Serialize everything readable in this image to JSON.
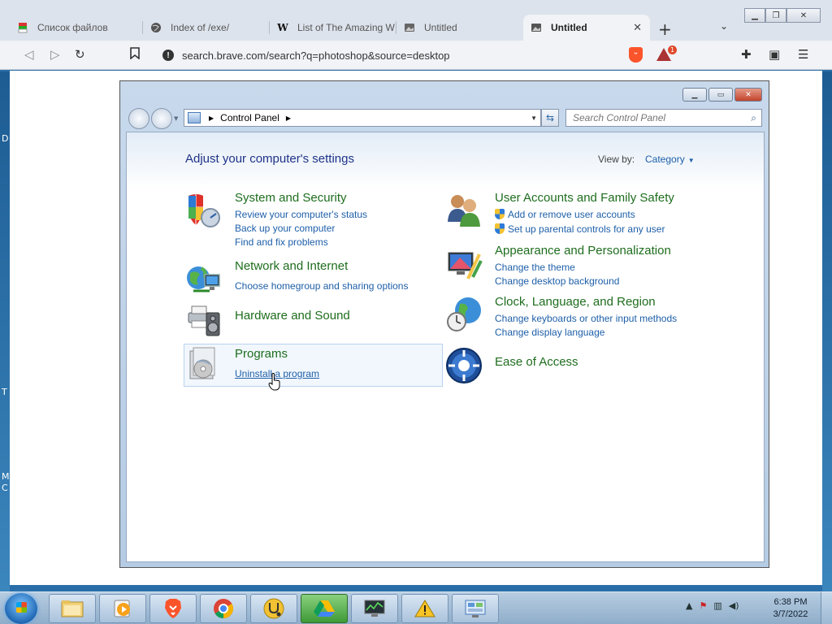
{
  "browser": {
    "tabs": [
      {
        "label": "Список файлов",
        "icon": "download-icon"
      },
      {
        "label": "Index of /exe/",
        "icon": "globe-icon"
      },
      {
        "label": "List of The Amazing W",
        "icon": "wikipedia-icon"
      },
      {
        "label": "Untitled",
        "icon": "image-icon"
      },
      {
        "label": "Untitled",
        "icon": "image-icon",
        "active": true
      }
    ],
    "url": "search.brave.com/search?q=photoshop&source=desktop",
    "rewards_badge": "1"
  },
  "control_panel": {
    "breadcrumb": "Control Panel",
    "search_placeholder": "Search Control Panel",
    "page_title": "Adjust your computer's settings",
    "view_by_label": "View by:",
    "view_by_value": "Category",
    "left_categories": [
      {
        "title": "System and Security",
        "links": [
          "Review your computer's status",
          "Back up your computer",
          "Find and fix problems"
        ]
      },
      {
        "title": "Network and Internet",
        "links": [
          "Choose homegroup and sharing options"
        ]
      },
      {
        "title": "Hardware and Sound",
        "links": []
      },
      {
        "title": "Programs",
        "links": [
          "Uninstall a program"
        ]
      }
    ],
    "right_categories": [
      {
        "title": "User Accounts and Family Safety",
        "links": [
          "Add or remove user accounts",
          "Set up parental controls for any user"
        ]
      },
      {
        "title": "Appearance and Personalization",
        "links": [
          "Change the theme",
          "Change desktop background"
        ]
      },
      {
        "title": "Clock, Language, and Region",
        "links": [
          "Change keyboards or other input methods",
          "Change display language"
        ]
      },
      {
        "title": "Ease of Access",
        "links": []
      }
    ]
  },
  "taskbar": {
    "time": "6:38 PM",
    "date": "3/7/2022"
  },
  "desktop": {
    "edge_letters": [
      "D",
      "T",
      "M",
      "C"
    ]
  }
}
